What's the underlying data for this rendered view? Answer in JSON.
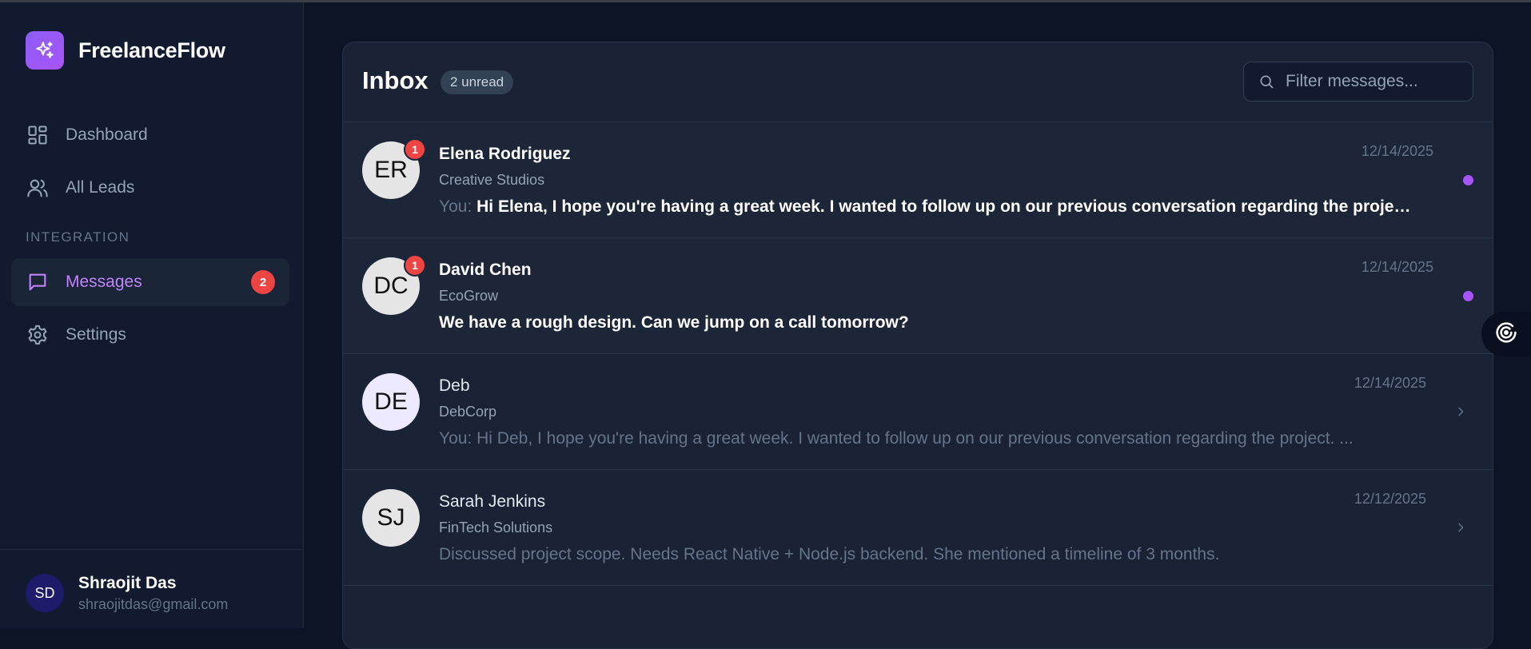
{
  "brand": {
    "name": "FreelanceFlow",
    "logo_icon": "sparkles-icon",
    "accent": "#8b5cf6"
  },
  "nav": {
    "items": [
      {
        "label": "Dashboard",
        "icon": "dashboard-grid-icon"
      },
      {
        "label": "All Leads",
        "icon": "users-icon"
      }
    ],
    "section_label": "INTEGRATION",
    "integration_items": [
      {
        "label": "Messages",
        "icon": "message-icon",
        "badge": "2",
        "active": true
      },
      {
        "label": "Settings",
        "icon": "gear-icon"
      }
    ]
  },
  "user": {
    "initials": "SD",
    "name": "Shraojit Das",
    "email": "shraojitdas@gmail.com"
  },
  "inbox": {
    "title": "Inbox",
    "unread_badge": "2 unread",
    "filter_placeholder": "Filter messages...",
    "messages": [
      {
        "initials": "ER",
        "name": "Elena Rodriguez",
        "company": "Creative Studios",
        "prefix": "You:",
        "preview": "Hi Elena, I hope you're having a great week. I wanted to follow up on our previous conversation regarding the project....",
        "date": "12/14/2025",
        "unread_count": "1",
        "unread": true
      },
      {
        "initials": "DC",
        "name": "David Chen",
        "company": "EcoGrow",
        "prefix": "",
        "preview": "We have a rough design. Can we jump on a call tomorrow?",
        "date": "12/14/2025",
        "unread_count": "1",
        "unread": true
      },
      {
        "initials": "DE",
        "name": "Deb",
        "company": "DebCorp",
        "prefix": "You:",
        "preview": "Hi Deb, I hope you're having a great week. I wanted to follow up on our previous conversation regarding the project. ...",
        "date": "12/14/2025",
        "unread": false
      },
      {
        "initials": "SJ",
        "name": "Sarah Jenkins",
        "company": "FinTech Solutions",
        "prefix": "",
        "preview": "Discussed project scope. Needs React Native + Node.js backend. She mentioned a timeline of 3 months.",
        "date": "12/12/2025",
        "unread": false
      }
    ]
  },
  "colors": {
    "unread_dot": "#a855f7",
    "badge": "#ef4444",
    "active_nav": "#c084fc"
  }
}
